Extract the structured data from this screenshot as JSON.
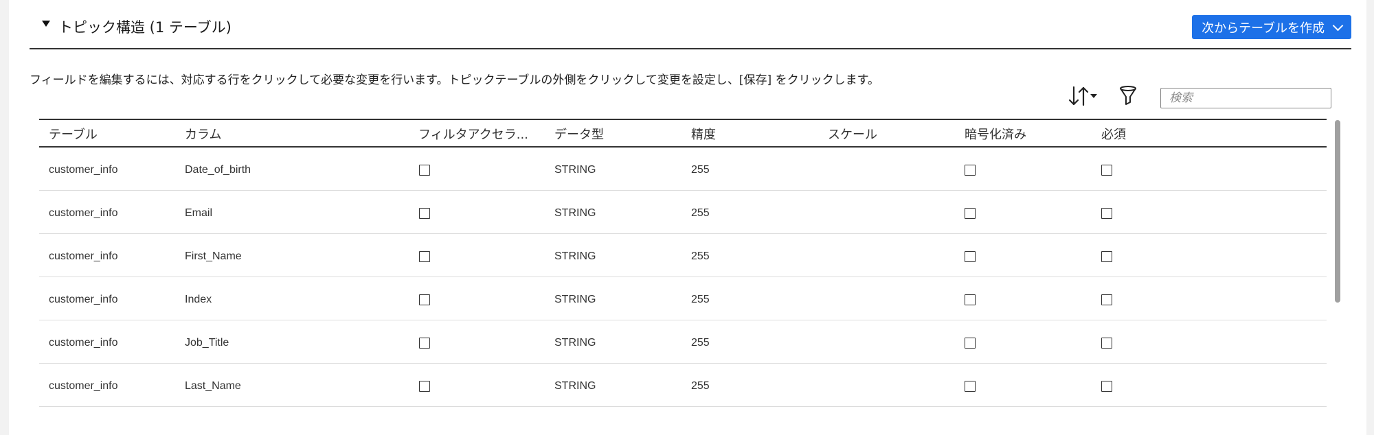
{
  "section": {
    "title": "トピック構造 (1 テーブル)",
    "create_button_label": "次からテーブルを作成"
  },
  "instructions": "フィールドを編集するには、対応する行をクリックして必要な変更を行います。トピックテーブルの外側をクリックして変更を設定し、[保存] をクリックします。",
  "search": {
    "placeholder": "検索",
    "value": ""
  },
  "icons": {
    "sort": "sort-icon",
    "filter": "filter-icon",
    "toggle": "caret-down-icon",
    "dropdown": "chevron-down-icon"
  },
  "colors": {
    "accent": "#1d71e8",
    "header_rule": "#333333",
    "row_divider": "#dcdcdc"
  },
  "table": {
    "columns": [
      "テーブル",
      "カラム",
      "フィルタアクセラ...",
      "データ型",
      "精度",
      "スケール",
      "暗号化済み",
      "必須"
    ],
    "rows": [
      {
        "table": "customer_info",
        "column": "Date_of_birth",
        "filter_accelerator": false,
        "data_type": "STRING",
        "precision": "255",
        "scale": "",
        "encrypted": false,
        "required": false
      },
      {
        "table": "customer_info",
        "column": "Email",
        "filter_accelerator": false,
        "data_type": "STRING",
        "precision": "255",
        "scale": "",
        "encrypted": false,
        "required": false
      },
      {
        "table": "customer_info",
        "column": "First_Name",
        "filter_accelerator": false,
        "data_type": "STRING",
        "precision": "255",
        "scale": "",
        "encrypted": false,
        "required": false
      },
      {
        "table": "customer_info",
        "column": "Index",
        "filter_accelerator": false,
        "data_type": "STRING",
        "precision": "255",
        "scale": "",
        "encrypted": false,
        "required": false
      },
      {
        "table": "customer_info",
        "column": "Job_Title",
        "filter_accelerator": false,
        "data_type": "STRING",
        "precision": "255",
        "scale": "",
        "encrypted": false,
        "required": false
      },
      {
        "table": "customer_info",
        "column": "Last_Name",
        "filter_accelerator": false,
        "data_type": "STRING",
        "precision": "255",
        "scale": "",
        "encrypted": false,
        "required": false
      }
    ]
  }
}
